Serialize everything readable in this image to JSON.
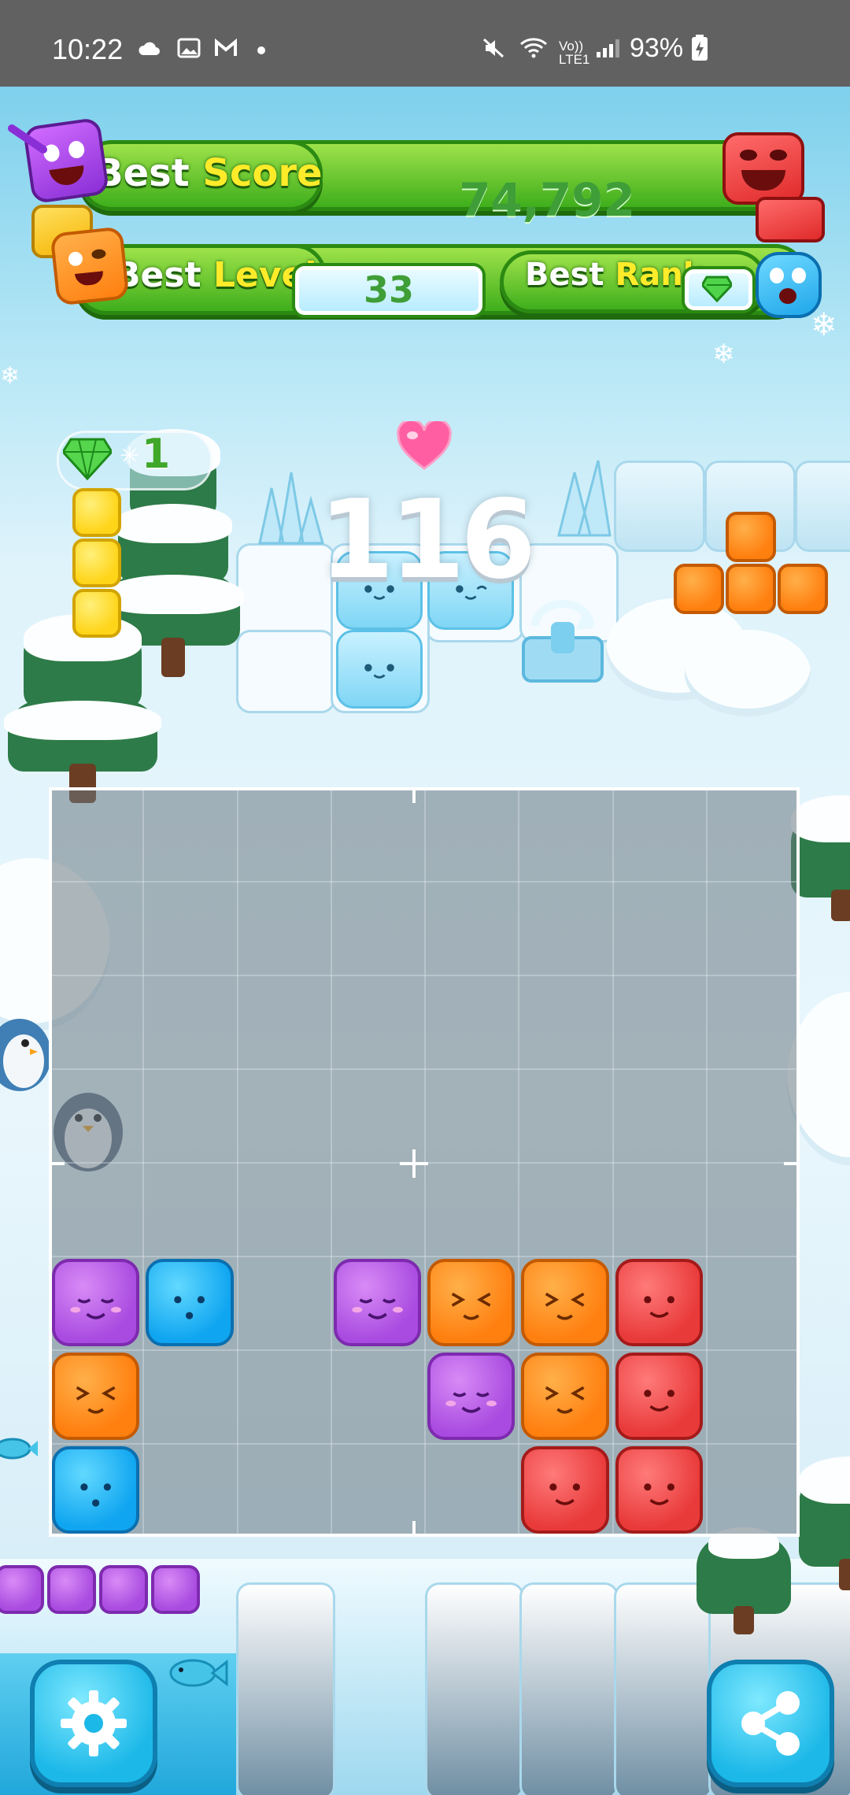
{
  "status_bar": {
    "time": "10:22",
    "network": "Vo)) LTE1",
    "battery": "93%"
  },
  "header": {
    "best_score": {
      "label_a": "Best",
      "label_b": "Score",
      "value": "74,792"
    },
    "best_level": {
      "label_a": "Best",
      "label_b": "Level",
      "value": "33"
    },
    "best_rank": {
      "label_a": "Best",
      "label_b": "Rank",
      "icon": "gem-icon"
    }
  },
  "game": {
    "gems": "1",
    "score": "116",
    "board": {
      "rows": 8,
      "cols": 8,
      "placed_blocks": [
        {
          "row": 5,
          "col": 0,
          "color": "purple"
        },
        {
          "row": 5,
          "col": 1,
          "color": "blue"
        },
        {
          "row": 5,
          "col": 3,
          "color": "purple"
        },
        {
          "row": 5,
          "col": 4,
          "color": "orange"
        },
        {
          "row": 5,
          "col": 5,
          "color": "orange"
        },
        {
          "row": 5,
          "col": 6,
          "color": "red"
        },
        {
          "row": 6,
          "col": 0,
          "color": "orange"
        },
        {
          "row": 6,
          "col": 4,
          "color": "purple"
        },
        {
          "row": 6,
          "col": 5,
          "color": "orange"
        },
        {
          "row": 6,
          "col": 6,
          "color": "red"
        },
        {
          "row": 7,
          "col": 0,
          "color": "blue"
        },
        {
          "row": 7,
          "col": 5,
          "color": "red"
        },
        {
          "row": 7,
          "col": 6,
          "color": "red"
        }
      ]
    },
    "pieces": {
      "yellow_vertical": {
        "color": "yellow",
        "length": 3
      },
      "orange_t": {
        "color": "orange",
        "shape": "T"
      },
      "purple_horizontal": {
        "color": "purple",
        "length": 4
      }
    }
  },
  "buttons": {
    "settings": "gear-icon",
    "share": "share-icon"
  },
  "colors": {
    "green": "#3fae1c",
    "purple": "#a94be0",
    "orange": "#ff7f0f",
    "red": "#e93a3a",
    "blue": "#0fa5f0",
    "yellow": "#ffd51a"
  }
}
